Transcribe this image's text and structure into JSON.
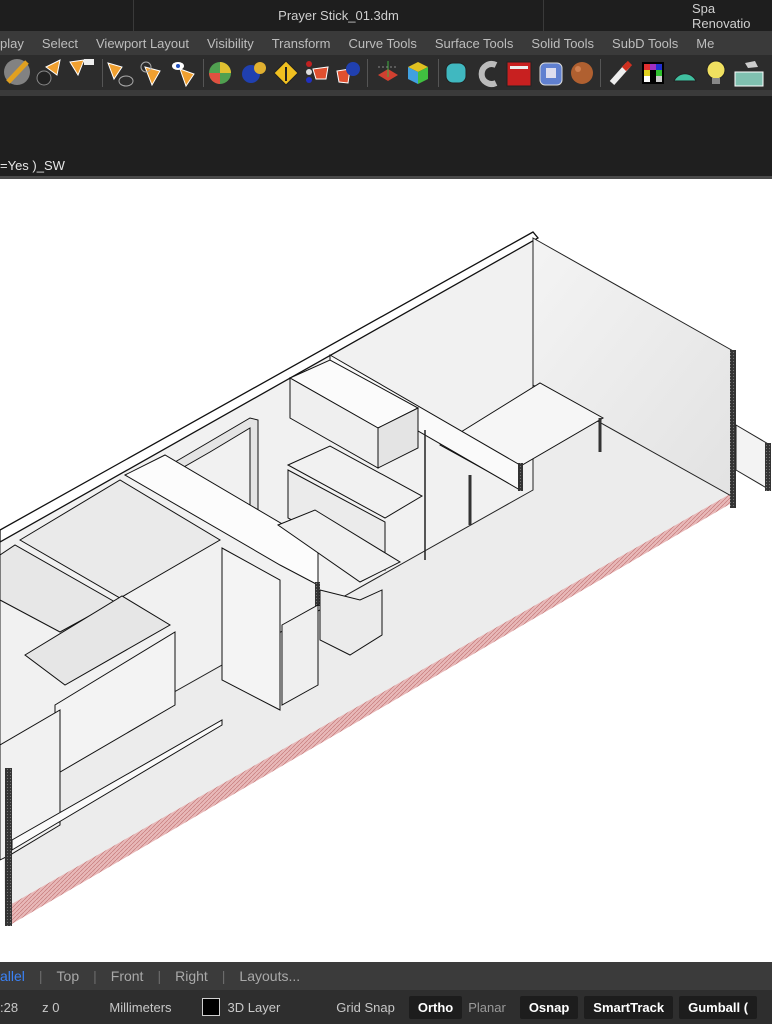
{
  "title_bar": {
    "tabs": [
      {
        "label": ""
      },
      {
        "label": "Prayer Stick_01.3dm"
      },
      {
        "label": "Spa Renovatio"
      }
    ]
  },
  "menu": {
    "items": [
      "play",
      "Select",
      "Viewport Layout",
      "Visibility",
      "Transform",
      "Curve Tools",
      "Surface Tools",
      "Solid Tools",
      "SubD Tools",
      "Me"
    ]
  },
  "toolbar": {
    "icons": [
      "line-tool-icon",
      "select-point-icon",
      "select-last-icon",
      "select-curve-icon",
      "select-rotate-icon",
      "select-visible-icon",
      "color-sphere-icon",
      "group-spheres-icon",
      "merge-sign-icon",
      "layer-traffic-icon",
      "boolean-union-icon",
      "gumball-axes-icon",
      "color-cube-icon",
      "solid-cap-icon",
      "revolve-icon",
      "extrude-red-icon",
      "subd-box-icon",
      "render-sphere-icon",
      "paint-brush-icon",
      "material-grid-icon",
      "dome-light-icon",
      "bulb-light-icon",
      "ground-plane-icon"
    ]
  },
  "command": {
    "history_text": "=Yes )_SW"
  },
  "viewport_tabs": {
    "items": [
      {
        "label": "allel",
        "active": true
      },
      {
        "label": "Top",
        "active": false
      },
      {
        "label": "Front",
        "active": false
      },
      {
        "label": "Right",
        "active": false
      },
      {
        "label": "Layouts...",
        "active": false
      }
    ],
    "separator": "|"
  },
  "status": {
    "coord_y": ":28",
    "coord_z": "z 0",
    "units": "Millimeters",
    "layer_color": "#000000",
    "layer": "3D Layer",
    "grid_snap": "Grid Snap",
    "ortho": "Ortho",
    "planar": "Planar",
    "osnap": "Osnap",
    "smarttrack": "SmartTrack",
    "gumball": "Gumball ("
  },
  "colors": {
    "accent": "#3b82f6",
    "section_cut": "#d9a0a0"
  }
}
